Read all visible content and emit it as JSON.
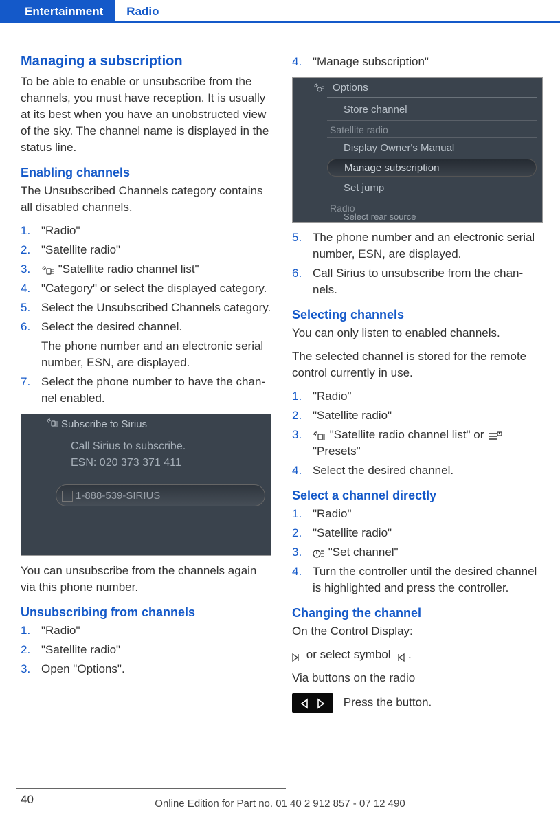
{
  "tabs": {
    "active": "Entertainment",
    "inactive": "Radio"
  },
  "left": {
    "h1": "Managing a subscription",
    "p1": "To be able to enable or unsubscribe from the channels, you must have reception. It is usually at its best when you have an unobstructed view of the sky. The channel name is displayed in the status line.",
    "h2a": "Enabling channels",
    "p2": "The Unsubscribed Channels category contains all disabled channels.",
    "ol1": {
      "i1": "\"Radio\"",
      "i2": "\"Satellite radio\"",
      "i3": "\"Satellite radio channel list\"",
      "i4": "\"Category\" or select the displayed category.",
      "i5": "Select the Unsubscribed Channels cate­gory.",
      "i6": "Select the desired channel.",
      "i6b": "The phone number and an electronic serial number, ESN, are displayed.",
      "i7": "Select the phone number to have the chan­nel enabled."
    },
    "ss1": {
      "header": "Subscribe to Sirius",
      "line1": "Call Sirius to subscribe.",
      "line2": "ESN: 020 373 371 411",
      "pill": "1-888-539-SIRIUS"
    },
    "p3": "You can unsubscribe from the channels again via this phone number.",
    "h2b": "Unsubscribing from channels",
    "ol2": {
      "i1": "\"Radio\"",
      "i2": "\"Satellite radio\"",
      "i3": "Open \"Options\"."
    }
  },
  "right": {
    "ol1_start4": "\"Manage subscription\"",
    "ss2": {
      "header": "Options",
      "r1": "Store channel",
      "group1": "Satellite radio",
      "r2": "Display Owner's Manual",
      "sel": "Manage subscription",
      "r3": "Set jump",
      "group2": "Radio",
      "r4": "Select rear source"
    },
    "ol1_5": "The phone number and an electronic serial number, ESN, are displayed.",
    "ol1_6": "Call Sirius to unsubscribe from the chan­nels.",
    "h2a": "Selecting channels",
    "p1": "You can only listen to enabled channels.",
    "p2": "The selected channel is stored for the remote control currently in use.",
    "ol2": {
      "i1": "\"Radio\"",
      "i2": "\"Satellite radio\"",
      "i3a": "\"Satellite radio channel list\" or",
      "i3b": "\"Presets\"",
      "i4": "Select the desired channel."
    },
    "h2b": "Select a channel directly",
    "ol3": {
      "i1": "\"Radio\"",
      "i2": "\"Satellite radio\"",
      "i3": "\"Set channel\"",
      "i4": "Turn the controller until the desired channel is highlighted and press the controller."
    },
    "h2c": "Changing the channel",
    "p3": "On the Control Display:",
    "p4a": "or select symbol",
    "p4b": ".",
    "p5": "Via buttons on the radio",
    "p6": "Press the button."
  },
  "footer": {
    "page": "40",
    "line": "Online Edition for Part no. 01 40 2 912 857 - 07 12 490"
  }
}
